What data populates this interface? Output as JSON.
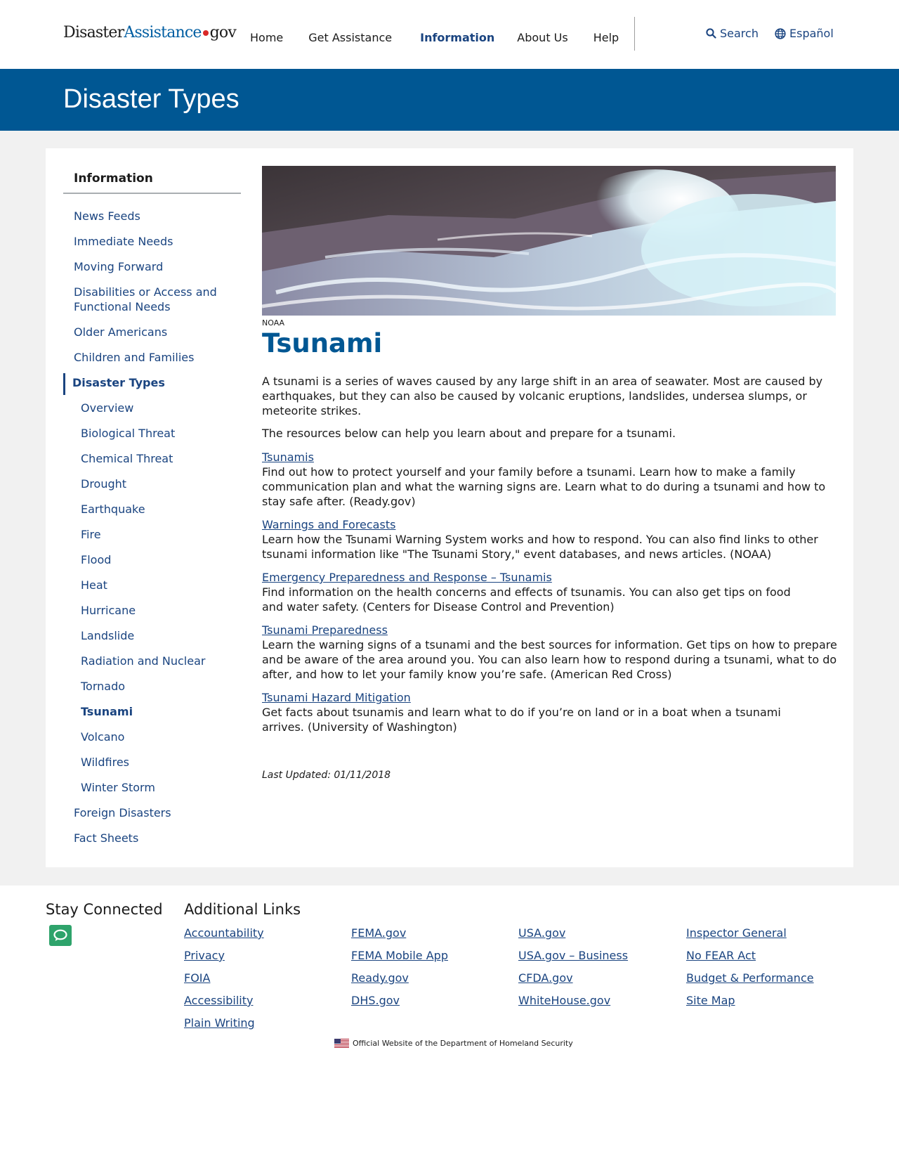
{
  "header": {
    "logo": {
      "part1": "Disaster",
      "part2": "Assistance",
      "part3": "gov"
    },
    "nav": [
      "Home",
      "Get Assistance",
      "Information",
      "About Us",
      "Help"
    ],
    "active_nav": "Information",
    "search_label": "Search",
    "language_label": "Español"
  },
  "banner": {
    "title": "Disaster Types"
  },
  "sidebar": {
    "heading": "Information",
    "items": [
      {
        "label": "News Feeds"
      },
      {
        "label": "Immediate Needs"
      },
      {
        "label": "Moving Forward"
      },
      {
        "label": "Disabilities or Access and"
      },
      {
        "label": "Functional Needs"
      },
      {
        "label": "Older Americans"
      },
      {
        "label": "Children and Families"
      },
      {
        "label": "Disaster Types"
      },
      {
        "label": "Overview"
      },
      {
        "label": "Biological Threat"
      },
      {
        "label": "Chemical Threat"
      },
      {
        "label": "Drought"
      },
      {
        "label": "Earthquake"
      },
      {
        "label": "Fire"
      },
      {
        "label": "Flood"
      },
      {
        "label": "Heat"
      },
      {
        "label": "Hurricane"
      },
      {
        "label": "Landslide"
      },
      {
        "label": "Radiation and Nuclear"
      },
      {
        "label": "Tornado"
      },
      {
        "label": "Tsunami"
      },
      {
        "label": "Volcano"
      },
      {
        "label": "Wildfires"
      },
      {
        "label": "Winter Storm"
      },
      {
        "label": "Foreign Disasters"
      },
      {
        "label": "Fact Sheets"
      }
    ]
  },
  "content": {
    "image_credit": "NOAA",
    "title": "Tsunami",
    "intro": "A tsunami is a series of waves caused by any large shift in an area of seawater. Most are caused by earthquakes, but they can also be caused by volcanic eruptions, landslides, undersea slumps, or meteorite strikes.",
    "resources_intro": "The resources below can help you learn about and prepare for a tsunami.",
    "resources": [
      {
        "link": "Tsunamis",
        "description": "Find out how to protect yourself and your family before a tsunami. Learn how to make a family communication plan and what the warning signs are. Learn what to do during a tsunami and how to stay safe after. (Ready.gov)"
      },
      {
        "link": "Warnings and Forecasts",
        "description": "Learn how the Tsunami Warning System works and how to respond. You can also find links to other tsunami information like \"The Tsunami Story,\" event databases, and news articles. (NOAA)"
      },
      {
        "link": "Emergency Preparedness and Response – Tsunamis",
        "description": "Find information on the health concerns and effects of tsunamis. You can also get tips on food and water safety. (Centers for Disease Control and Prevention)"
      },
      {
        "link": "Tsunami Preparedness",
        "description": "Learn the warning signs of a tsunami and the best sources for information. Get tips on how to prepare and be aware of the area around you. You can also learn how to respond during a tsunami, what to do after, and how to let your family know you’re safe. (American Red Cross)"
      },
      {
        "link": "Tsunami Hazard Mitigation",
        "description": "Get facts about tsunamis and learn what to do if you’re on land or in a boat when a tsunami arrives. (University of Washington)"
      }
    ],
    "last_updated": "Last Updated: 01/11/2018"
  },
  "footer": {
    "stay_connected": "Stay Connected",
    "additional_links": "Additional Links",
    "columns": [
      [
        "Accountability",
        "Privacy",
        "FOIA",
        "Accessibility",
        "Plain Writing"
      ],
      [
        "FEMA.gov",
        "FEMA Mobile App",
        "Ready.gov",
        "DHS.gov"
      ],
      [
        "USA.gov",
        "USA.gov – Business",
        "CFDA.gov",
        "WhiteHouse.gov"
      ],
      [
        "Inspector General",
        "No FEAR Act",
        "Budget & Performance",
        "Site Map"
      ]
    ],
    "official": "Official Website of the Department of Homeland Security"
  },
  "colors": {
    "brand_blue": "#005793",
    "link_blue": "#1a4480",
    "logo_dot": "#d92828",
    "chat_green": "#2ea36b"
  }
}
